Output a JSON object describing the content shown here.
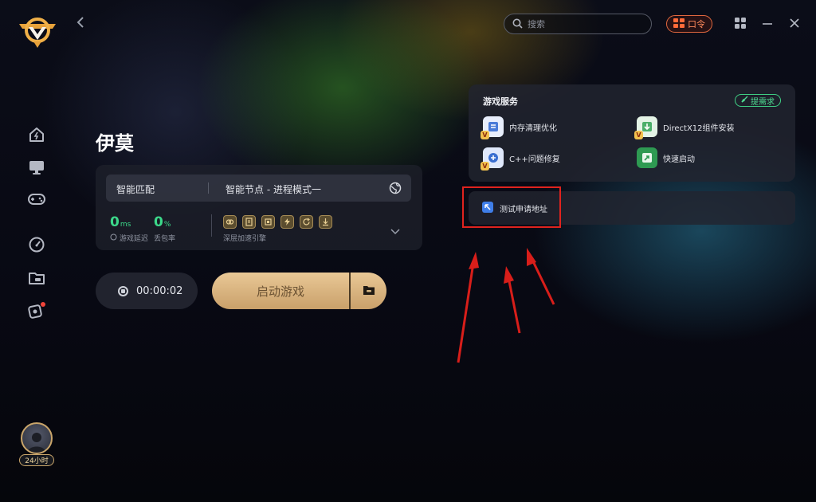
{
  "app": {
    "logo": "ak-shield-logo"
  },
  "sidebar": {
    "items": [
      {
        "name": "home",
        "icon": "home-icon"
      },
      {
        "name": "monitor",
        "icon": "monitor-icon"
      },
      {
        "name": "games",
        "icon": "gamepad-icon"
      },
      {
        "name": "speedtest",
        "icon": "gauge-icon"
      },
      {
        "name": "folder",
        "icon": "folder-icon"
      },
      {
        "name": "support",
        "icon": "support-icon"
      }
    ],
    "avatar_badge": "24小时"
  },
  "topbar": {
    "search_placeholder": "搜索",
    "koling_label": "口令",
    "back_icon": "chevron-left-icon"
  },
  "game": {
    "title": "伊莫",
    "match_mode": "智能匹配",
    "node_mode": "智能节点 - 进程模式一",
    "latency_value": "0",
    "latency_unit": "ms",
    "latency_caption": "游戏延迟",
    "loss_value": "0",
    "loss_unit": "%",
    "loss_caption": "丢包率",
    "engine_caption": "深层加速引擎"
  },
  "controls": {
    "timer": "00:00:02",
    "start_label": "启动游戏"
  },
  "services": {
    "title": "游戏服务",
    "demand_label": "提需求",
    "items": [
      {
        "label": "内存清理优化",
        "icon": "memory-clean-icon",
        "color": "#4a7bd8"
      },
      {
        "label": "DirectX12组件安装",
        "icon": "directx-install-icon",
        "color": "#4caf6a"
      },
      {
        "label": "C++问题修复",
        "icon": "cpp-repair-icon",
        "color": "#3a6fd0"
      },
      {
        "label": "快速启动",
        "icon": "quick-launch-icon",
        "color": "#2e9a52"
      }
    ],
    "test_addr_label": "测试申请地址"
  },
  "colors": {
    "accent_green": "#3cd88a",
    "gold": "#d7b27e",
    "highlight_red": "#e0231e"
  }
}
